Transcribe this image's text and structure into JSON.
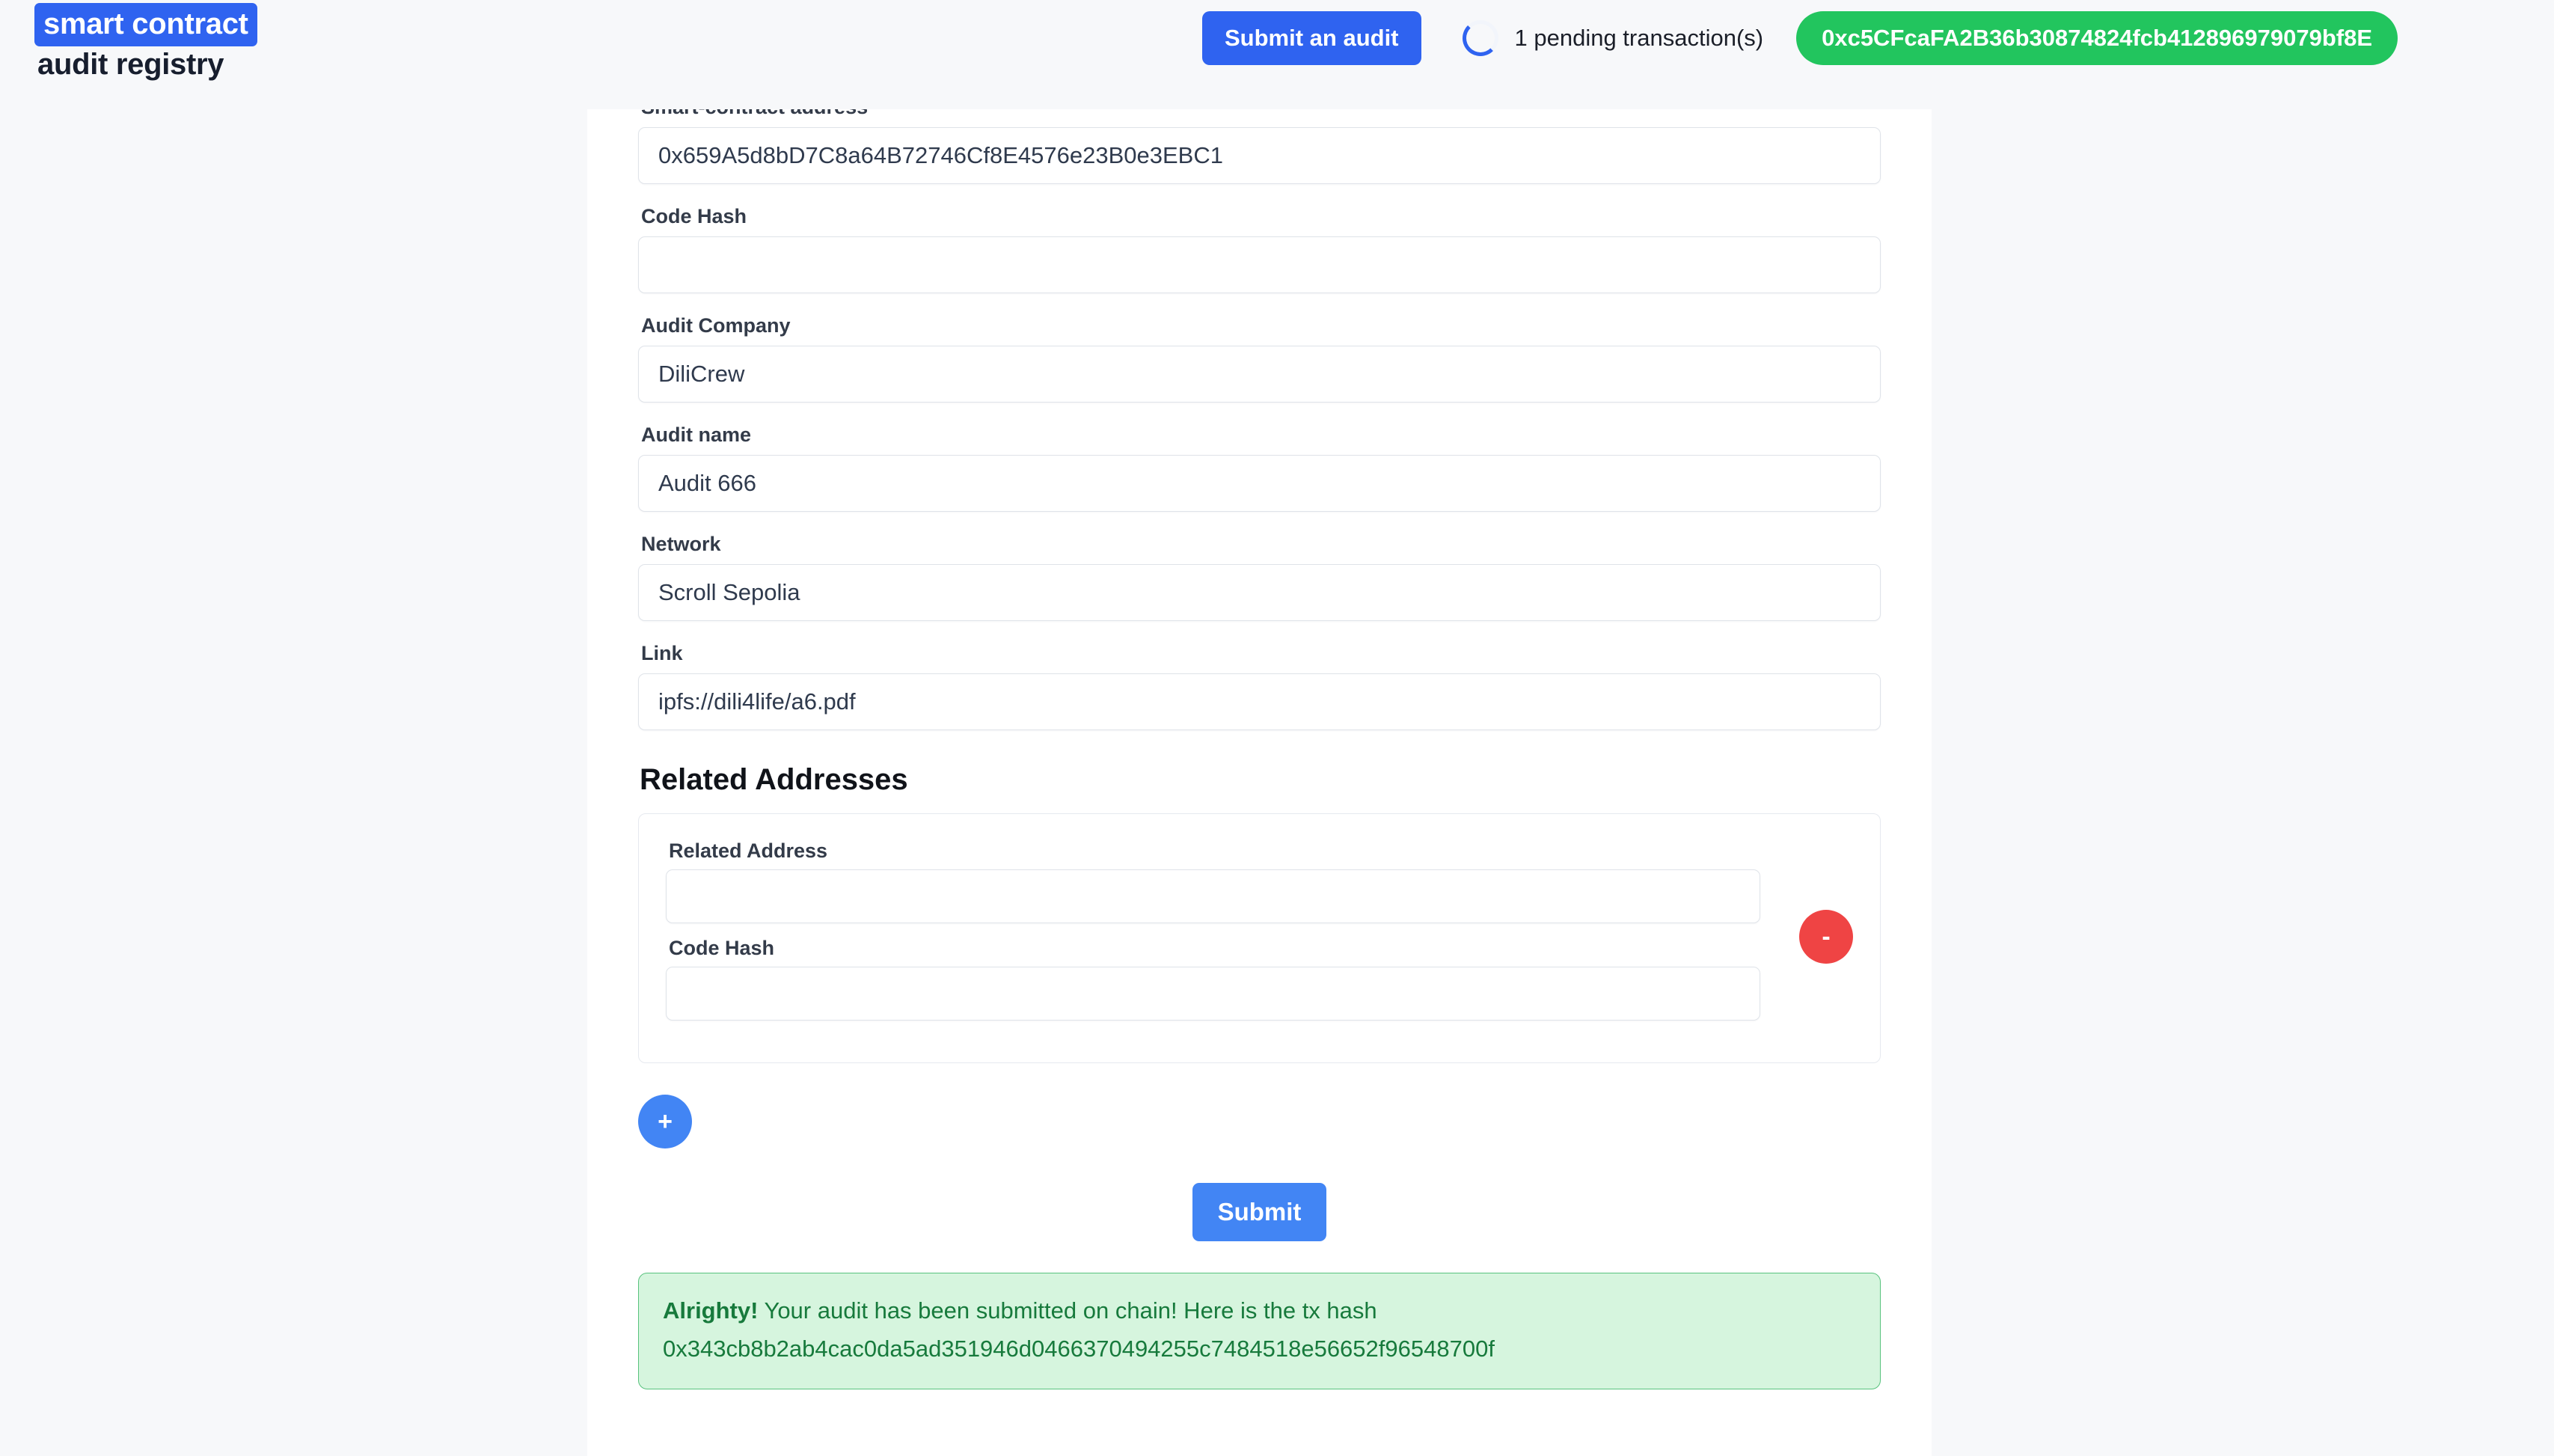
{
  "header": {
    "brand_line1": "smart contract",
    "brand_line2": "audit registry",
    "submit_audit_label": "Submit an audit",
    "pending_text": "1 pending transaction(s)",
    "wallet_address": "0xc5CFcaFA2B36b30874824fcb412896979079bf8E",
    "accent_blue": "#2f63f0",
    "wallet_green": "#22c55e"
  },
  "form": {
    "fields": [
      {
        "label": "Smart-contract address",
        "value": "0x659A5d8bD7C8a64B72746Cf8E4576e23B0e3EBC1",
        "placeholder": ""
      },
      {
        "label": "Code Hash",
        "value": "",
        "placeholder": ""
      },
      {
        "label": "Audit Company",
        "value": "DiliCrew",
        "placeholder": ""
      },
      {
        "label": "Audit name",
        "value": "Audit 666",
        "placeholder": ""
      },
      {
        "label": "Network",
        "value": "Scroll Sepolia",
        "placeholder": ""
      },
      {
        "label": "Link",
        "value": "ipfs://dili4life/a6.pdf",
        "placeholder": ""
      }
    ]
  },
  "related_addresses": {
    "section_title": "Related Addresses",
    "entries": [
      {
        "address_label": "Related Address",
        "address_value": "",
        "code_hash_label": "Code Hash",
        "code_hash_value": "",
        "remove_label": "-"
      }
    ],
    "add_label": "+",
    "remove_color": "#ef4444",
    "add_color": "#4285f4"
  },
  "submit": {
    "label": "Submit",
    "color": "#4285f4"
  },
  "alert": {
    "prefix": "Alrighty!",
    "message": " Your audit has been submitted on chain! Here is the tx hash",
    "tx_hash": "0x343cb8b2ab4cac0da5ad351946d0466370494255c7484518e56652f96548700f",
    "bg": "#d6f5de",
    "border": "#58c27d",
    "text_color": "#177a3c"
  }
}
